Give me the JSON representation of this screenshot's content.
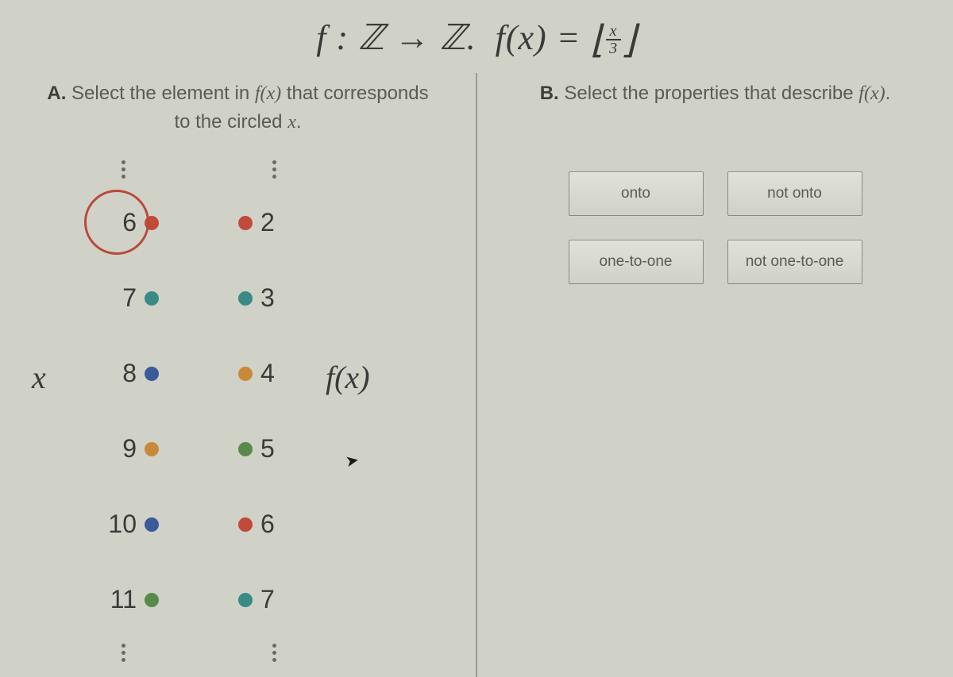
{
  "header": {
    "lhs": "f : ℤ → ℤ.",
    "rhs_f": "f(x) =",
    "frac_num": "x",
    "frac_den": "3"
  },
  "partA": {
    "label": "A.",
    "text1": "Select the element in",
    "fx": "f(x)",
    "text2": "that corresponds",
    "text3": "to the circled",
    "var": "x",
    "period": "."
  },
  "partB": {
    "label": "B.",
    "text1": "Select the properties that describe",
    "fx": "f(x)",
    "period": "."
  },
  "axis": {
    "x": "x",
    "fx": "f(x)"
  },
  "domain": [
    {
      "v": "6",
      "c": "red",
      "circled": true
    },
    {
      "v": "7",
      "c": "teal"
    },
    {
      "v": "8",
      "c": "blue"
    },
    {
      "v": "9",
      "c": "orange"
    },
    {
      "v": "10",
      "c": "blue"
    },
    {
      "v": "11",
      "c": "green"
    }
  ],
  "codomain": [
    {
      "v": "2",
      "c": "red"
    },
    {
      "v": "3",
      "c": "teal"
    },
    {
      "v": "4",
      "c": "orange"
    },
    {
      "v": "5",
      "c": "green"
    },
    {
      "v": "6",
      "c": "red"
    },
    {
      "v": "7",
      "c": "teal"
    }
  ],
  "buttons": {
    "onto": "onto",
    "not_onto": "not onto",
    "one_to_one": "one-to-one",
    "not_one_to_one": "not one-to-one"
  }
}
